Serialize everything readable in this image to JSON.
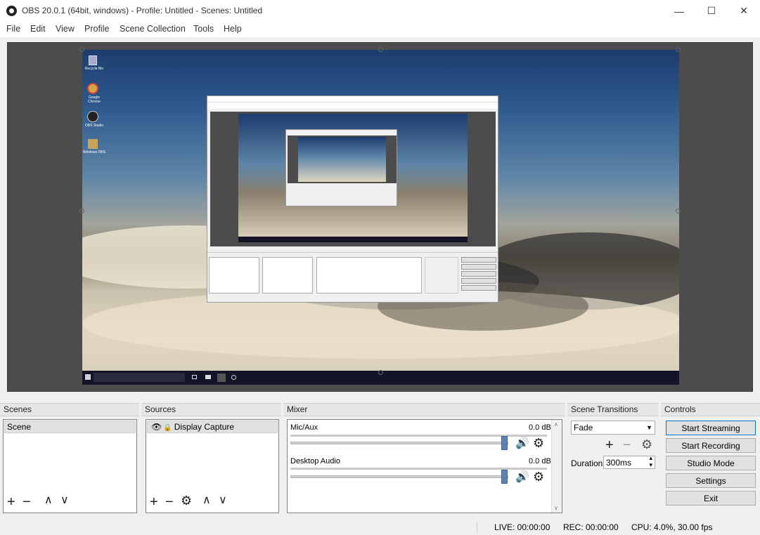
{
  "window": {
    "title": "OBS 20.0.1 (64bit, windows) - Profile: Untitled - Scenes: Untitled",
    "minimize_glyph": "—",
    "maximize_glyph": "☐",
    "close_glyph": "✕"
  },
  "menu": [
    "File",
    "Edit",
    "View",
    "Profile",
    "Scene Collection",
    "Tools",
    "Help"
  ],
  "desktop_icons": [
    "Recycle Bin",
    "Google Chrome",
    "OBS Studio",
    "Windows OBS"
  ],
  "docks": {
    "scenes": {
      "title": "Scenes",
      "items": [
        "Scene"
      ]
    },
    "sources": {
      "title": "Sources",
      "items": [
        {
          "label": "Display Capture",
          "visible_icon": "eye-icon",
          "lock_icon": "lock-icon"
        }
      ]
    },
    "mixer": {
      "title": "Mixer",
      "channels": [
        {
          "name": "Mic/Aux",
          "level": "0.0 dB",
          "volume": 1.0
        },
        {
          "name": "Desktop Audio",
          "level": "0.0 dB",
          "volume": 1.0
        }
      ]
    },
    "transitions": {
      "title": "Scene Transitions",
      "selected": "Fade",
      "duration_label": "Duration",
      "duration_value": "300ms"
    },
    "controls": {
      "title": "Controls",
      "buttons": [
        "Start Streaming",
        "Start Recording",
        "Studio Mode",
        "Settings",
        "Exit"
      ]
    }
  },
  "status": {
    "live": "LIVE: 00:00:00",
    "rec": "REC: 00:00:00",
    "cpu": "CPU: 4.0%, 30.00 fps"
  },
  "colors": {
    "slider_thumb": "#5884b3",
    "preview_bg": "#4c4c4c"
  }
}
